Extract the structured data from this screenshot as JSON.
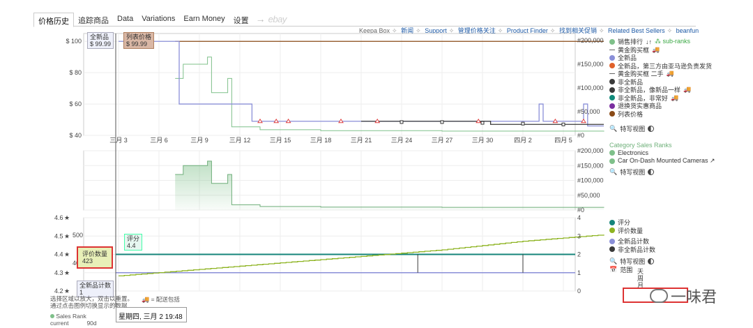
{
  "tabs": [
    {
      "label": "价格历史",
      "active": true
    },
    {
      "label": "追踪商品"
    },
    {
      "label": "Data"
    },
    {
      "label": "Variations"
    },
    {
      "label": "Earn Money"
    },
    {
      "label": "设置"
    }
  ],
  "tab_arrow": "→",
  "tab_ebay": "ebay",
  "links": [
    "Keepa Box",
    "新闻",
    "Support",
    "管理价格关注",
    "Product Finder",
    "找到相关促销",
    "Related Best Sellers",
    "beanfun"
  ],
  "legend_main": {
    "sales_rank": "销售排行",
    "sub_ranks": "sub-ranks",
    "items": [
      {
        "label": "黄金购买框",
        "kind": "dash",
        "truck": true
      },
      {
        "label": "全新品",
        "kind": "dot",
        "color": "#8a8fd8"
      },
      {
        "label": "全新品，第三方由亚马逊负责发货",
        "kind": "dot",
        "color": "#e0612b"
      },
      {
        "label": "黄金购买框 二手",
        "kind": "dash",
        "truck": true
      },
      {
        "label": "非全新品",
        "kind": "dot",
        "color": "#3a3a3a"
      },
      {
        "label": "非全新品，像新品一样",
        "kind": "dot",
        "color": "#3a3a3a",
        "truck": true
      },
      {
        "label": "非全新品，非常好",
        "kind": "dot",
        "color": "#108a7a",
        "truck": true
      },
      {
        "label": "退换货实惠商品",
        "kind": "dot",
        "color": "#7a2ea0"
      },
      {
        "label": "列表价格",
        "kind": "dot",
        "color": "#8a4a16"
      }
    ],
    "sketch_view": "特写视图"
  },
  "legend_rank": {
    "title": "Category Sales Ranks",
    "items": [
      {
        "label": "Electronics",
        "color": "#7fc08a"
      },
      {
        "label": "Car On-Dash Mounted Cameras ↗",
        "color": "#7fc08a"
      }
    ],
    "sketch_view": "特写视图"
  },
  "legend_rating": {
    "items": [
      {
        "label": "评分",
        "color": "#15857a"
      },
      {
        "label": "评价数量",
        "color": "#8db321"
      },
      {
        "label": "全新品计数",
        "color": "#8a8fd8"
      },
      {
        "label": "非全新品计数",
        "color": "#3a3a3a"
      }
    ],
    "sketch_view": "特写视图",
    "range_label": "范围",
    "range_words": [
      "天",
      "周",
      "月"
    ]
  },
  "tooltips": {
    "new": {
      "title": "全新品",
      "value": "$ 99.99"
    },
    "list": {
      "title": "列表价格",
      "value": "$ 99.99"
    },
    "rating": {
      "title": "评分",
      "value": "4.4"
    },
    "reviews": {
      "title": "评价数量",
      "value": "423"
    },
    "new_count": {
      "title": "全新品计数",
      "value": "1"
    }
  },
  "date_readout": "星期四, 三月 2 19:48",
  "notes": [
    "选择区域以放大，双击以重置。",
    "通过点击图例切换显示的数据"
  ],
  "truck_note": "= 配送包括",
  "sales_rank_label": "Sales Rank",
  "current_label": "current",
  "days_label": "90d",
  "watermark": "一味君",
  "chart_data": [
    {
      "type": "line",
      "name": "price",
      "x": [
        "三月 3",
        "三月 6",
        "三月 9",
        "三月 12",
        "三月 15",
        "三月 18",
        "三月 21",
        "三月 24",
        "三月 27",
        "三月 30",
        "四月 2",
        "四月 5"
      ],
      "y_left_ticks": [
        "$ 40",
        "$ 60",
        "$ 80",
        "$ 100"
      ],
      "y_right_ticks": [
        "#0",
        "#50,000",
        "#100,000",
        "#150,000",
        "#200,000"
      ],
      "ylim": [
        40,
        105
      ],
      "series": [
        {
          "name": "列表价格",
          "color": "#8a4a16",
          "points": [
            [
              1.4,
              99.99
            ],
            [
              12,
              99.99
            ]
          ]
        },
        {
          "name": "全新品",
          "color": "#8a8fd8",
          "points": [
            [
              0,
              99.99
            ],
            [
              1.2,
              99.99
            ],
            [
              1.5,
              60
            ],
            [
              3.2,
              60
            ],
            [
              3.3,
              49
            ],
            [
              10.4,
              49
            ],
            [
              10.4,
              60
            ],
            [
              10.5,
              49
            ],
            [
              11.5,
              49
            ],
            [
              11.5,
              60
            ],
            [
              11.6,
              46
            ],
            [
              12,
              46
            ]
          ]
        },
        {
          "name": "非全新品",
          "color": "#3a3a3a",
          "points": [
            [
              6,
              49
            ],
            [
              9,
              49
            ],
            [
              9.2,
              47
            ],
            [
              12,
              47
            ]
          ]
        }
      ]
    },
    {
      "type": "area",
      "name": "sales rank",
      "y_right_ticks": [
        "#0",
        "#50,000",
        "#100,000",
        "#150,000",
        "#200,000"
      ],
      "ylim": [
        0,
        200000
      ],
      "series": [
        {
          "name": "Electronics",
          "color": "#7fc08a",
          "points": [
            [
              1.4,
              120000
            ],
            [
              1.6,
              150000
            ],
            [
              2.2,
              165000
            ],
            [
              2.3,
              90000
            ],
            [
              2.7,
              120000
            ],
            [
              2.8,
              18000
            ],
            [
              3.5,
              12000
            ],
            [
              5,
              10000
            ],
            [
              8,
              9000
            ],
            [
              12,
              8000
            ]
          ]
        }
      ]
    },
    {
      "type": "line",
      "name": "rating",
      "y_left_ticks": [
        "4.2",
        "4.3",
        "4.4",
        "4.5",
        "4.6"
      ],
      "y_mid_ticks": [
        "400",
        "500"
      ],
      "y_right_ticks": [
        "0",
        "1",
        "2",
        "3",
        "4"
      ],
      "series": [
        {
          "name": "评分",
          "color": "#15857a",
          "value": 4.4
        },
        {
          "name": "评价数量",
          "color": "#8db321",
          "points": [
            [
              0,
              410
            ],
            [
              2,
              425
            ],
            [
              4,
              440
            ],
            [
              6,
              455
            ],
            [
              8,
              470
            ],
            [
              10,
              490
            ],
            [
              12,
              505
            ]
          ]
        },
        {
          "name": "全新品计数",
          "color": "#8a8fd8",
          "value": 1
        },
        {
          "name": "非全新品计数",
          "color": "#3a3a3a",
          "value": 1
        }
      ]
    }
  ]
}
